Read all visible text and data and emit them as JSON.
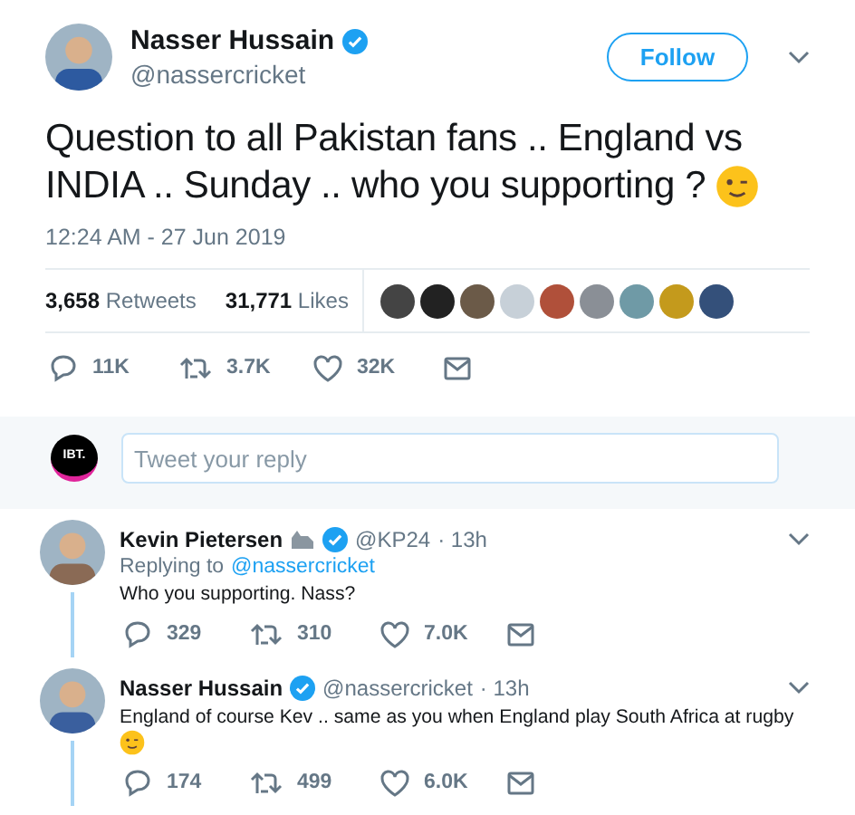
{
  "tweet": {
    "name": "Nasser Hussain",
    "verified": true,
    "handle": "@nassercricket",
    "follow": "Follow",
    "text": "Question to all Pakistan fans .. England vs INDIA .. Sunday .. who you supporting ?",
    "emoji": true,
    "time": "12:24 AM - 27 Jun 2019",
    "stats": [
      "**3,658** Retweets",
      "**31,771** Likes"
    ],
    "likers": [
      {
        "color": "#444444"
      },
      {
        "color": "#222222"
      },
      {
        "color": "#6b5a48"
      },
      {
        "color": "#c7d0d8"
      },
      {
        "color": "#b0503a"
      },
      {
        "color": "#8a8f96"
      },
      {
        "color": "#6f9aa6"
      },
      {
        "color": "#c49a1c"
      },
      {
        "color": "#34507a"
      }
    ],
    "actions": {
      "replies": "11K",
      "retweets": "3.7K",
      "likes": "32K"
    }
  },
  "compose": {
    "avatar": "IBT.",
    "placeholder": "Tweet your reply"
  },
  "replies": [
    {
      "name": "Kevin Pietersen",
      "badge": true,
      "verified": true,
      "handle": "@KP24",
      "age": "· 13h",
      "replying_to": "Replying to",
      "replying_handle": "@nassercricket",
      "text": "Who you supporting. Nass?",
      "emoji": false,
      "actions": {
        "replies": "329",
        "retweets": "310",
        "likes": "7.0K"
      }
    },
    {
      "name": "Nasser Hussain",
      "badge": false,
      "verified": true,
      "handle": "@nassercricket",
      "age": "· 13h",
      "text": "England of course Kev .. same as you when England play South Africa at rugby",
      "emoji": true,
      "actions": {
        "replies": "174",
        "retweets": "499",
        "likes": "6.0K"
      }
    }
  ]
}
